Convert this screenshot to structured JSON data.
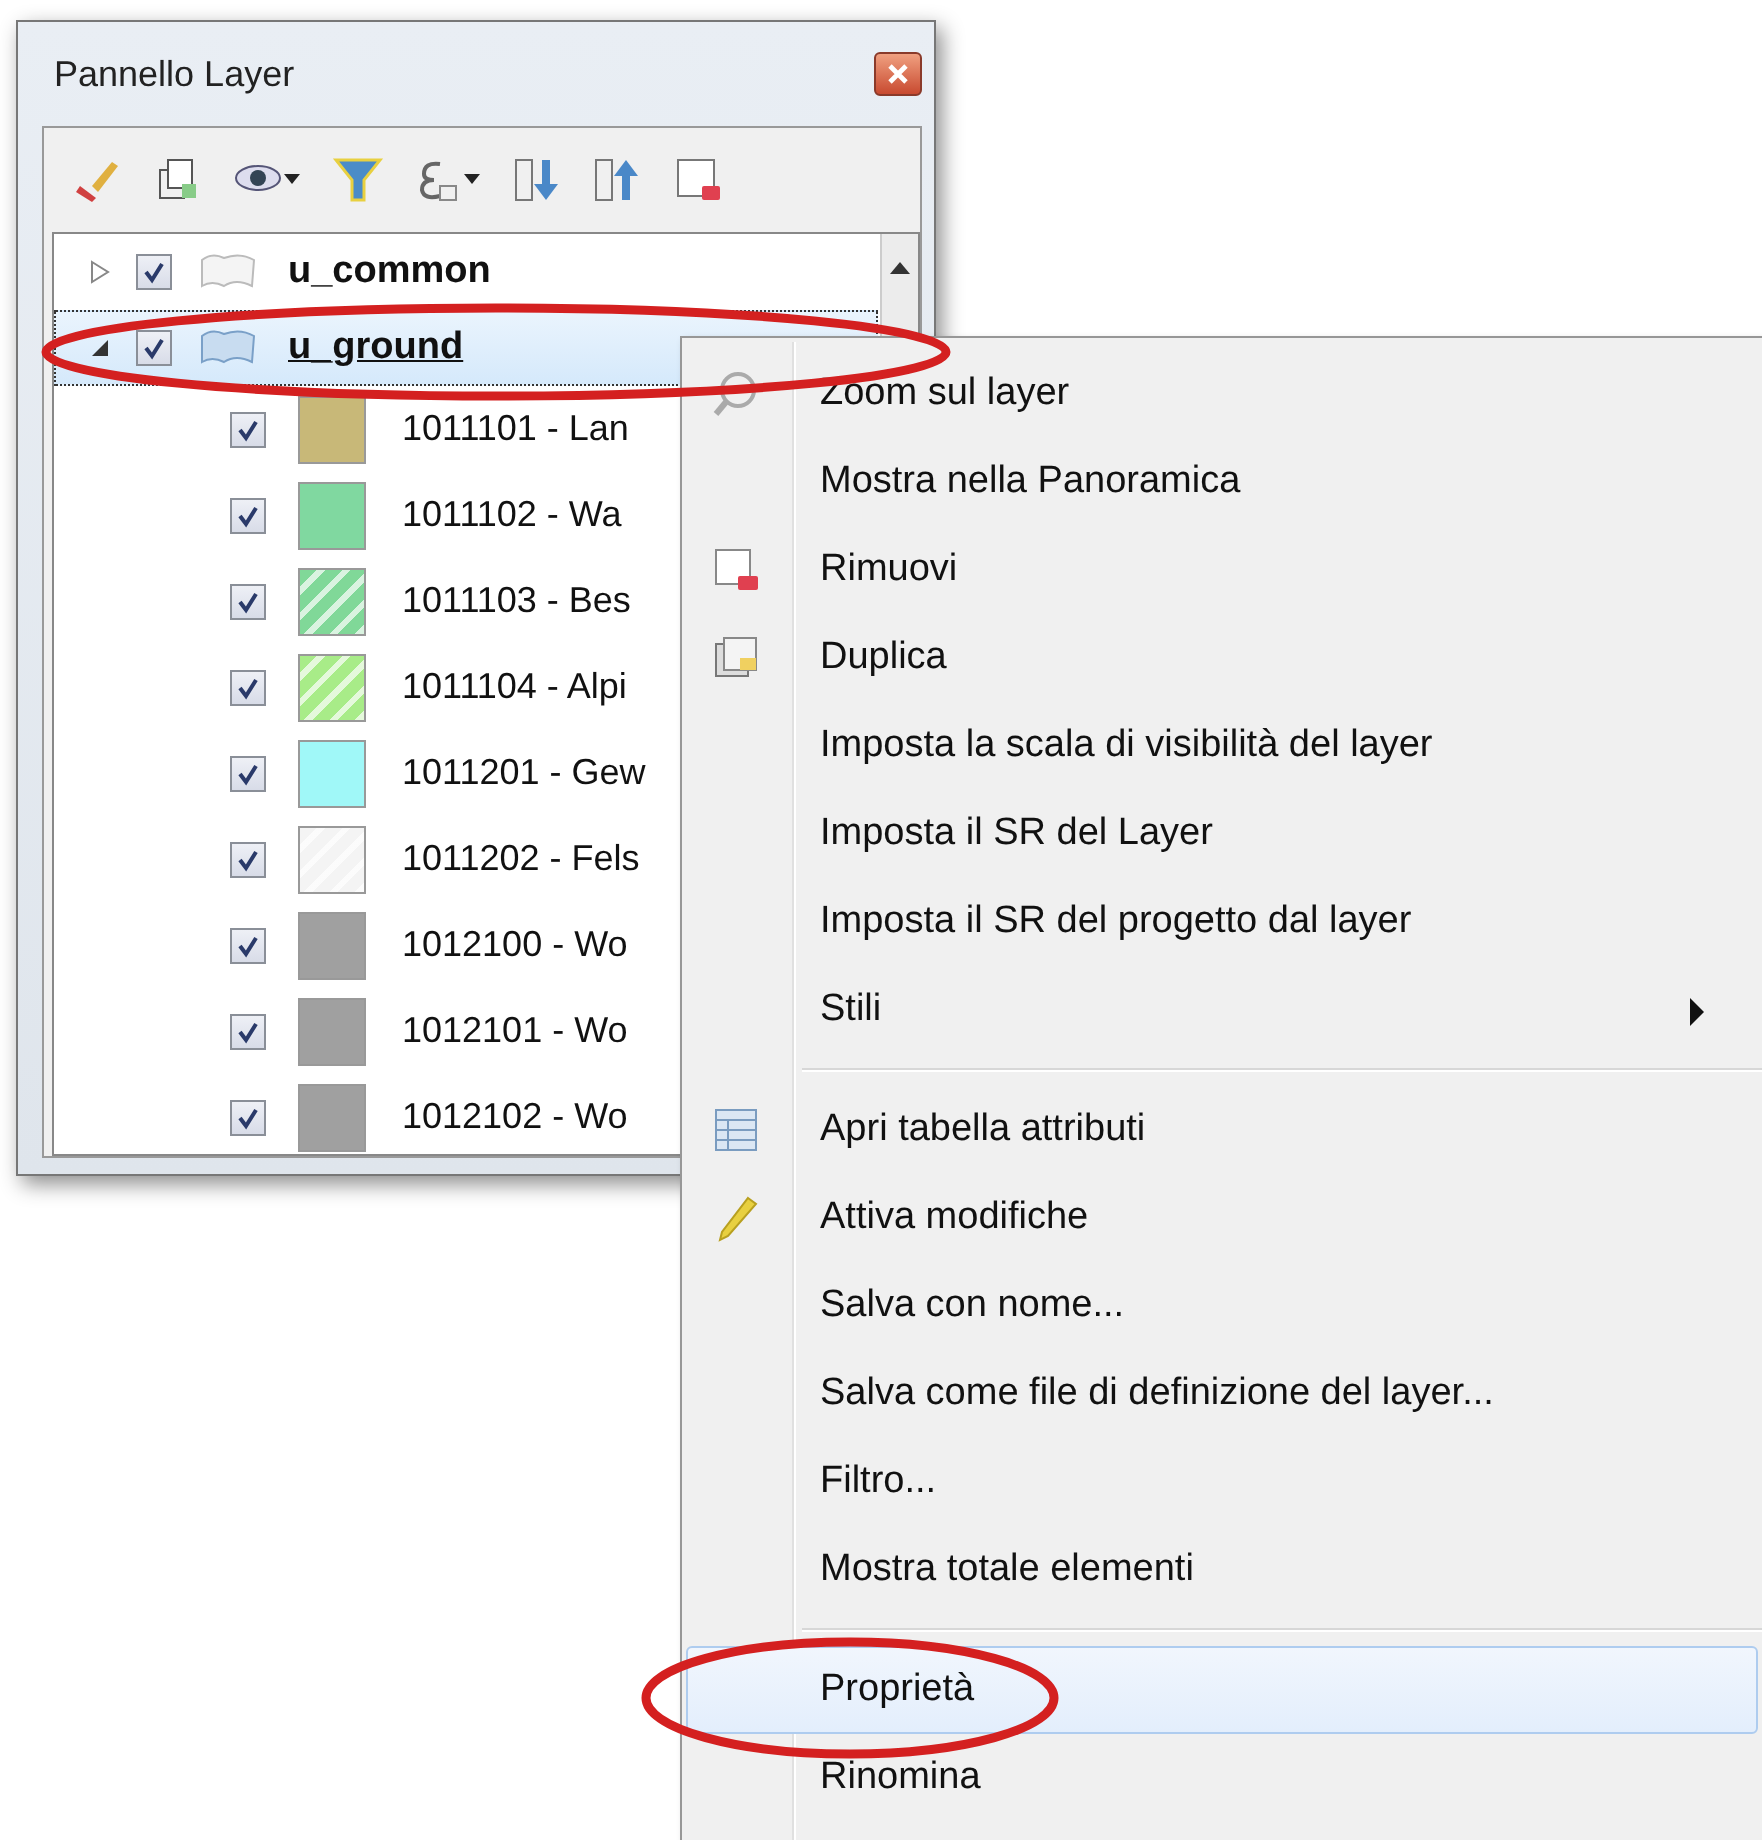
{
  "panel": {
    "title": "Pannello Layer",
    "toolbar": [
      {
        "kind": "brush"
      },
      {
        "kind": "add-group"
      },
      {
        "kind": "eye",
        "dropdown": true
      },
      {
        "kind": "filter"
      },
      {
        "kind": "expression",
        "dropdown": true
      },
      {
        "kind": "expand"
      },
      {
        "kind": "collapse"
      },
      {
        "kind": "remove"
      }
    ],
    "tree": [
      {
        "label": "u_common",
        "checked": true,
        "expanded": false,
        "selected": false
      },
      {
        "label": "u_ground",
        "checked": true,
        "expanded": true,
        "selected": true,
        "children": [
          {
            "label": "1011101 - Lan",
            "checked": true,
            "color": "#c8b878",
            "hatched": false
          },
          {
            "label": "1011102 - Wa",
            "checked": true,
            "color": "#80d8a0",
            "hatched": false
          },
          {
            "label": "1011103 - Bes",
            "checked": true,
            "color": "#80d898",
            "hatched": true
          },
          {
            "label": "1011104 - Alpi",
            "checked": true,
            "color": "#a8ec88",
            "hatched": true
          },
          {
            "label": "1011201 - Gew",
            "checked": true,
            "color": "#a0f8f8",
            "hatched": false
          },
          {
            "label": "1011202 - Fels",
            "checked": true,
            "color": "#f4f4f4",
            "hatched": true
          },
          {
            "label": "1012100 - Wo",
            "checked": true,
            "color": "#a0a0a0",
            "hatched": false
          },
          {
            "label": "1012101 - Wo",
            "checked": true,
            "color": "#a0a0a0",
            "hatched": false
          },
          {
            "label": "1012102 - Wo",
            "checked": true,
            "color": "#a0a0a0",
            "hatched": false
          }
        ]
      }
    ]
  },
  "context_menu": {
    "sections": [
      [
        {
          "label": "Zoom sul layer",
          "selected": false,
          "submenu": false
        },
        {
          "label": "Mostra nella Panoramica",
          "selected": false,
          "submenu": false
        },
        {
          "label": "Rimuovi",
          "selected": false,
          "submenu": false
        },
        {
          "label": "Duplica",
          "selected": false,
          "submenu": false
        },
        {
          "label": "Imposta la scala di visibilità del layer",
          "selected": false,
          "submenu": false
        },
        {
          "label": "Imposta il SR del Layer",
          "selected": false,
          "submenu": false
        },
        {
          "label": "Imposta il SR del progetto dal layer",
          "selected": false,
          "submenu": false
        },
        {
          "label": "Stili",
          "selected": false,
          "submenu": true
        }
      ],
      [
        {
          "label": "Apri tabella attributi",
          "selected": false,
          "submenu": false
        },
        {
          "label": "Attiva modifiche",
          "selected": false,
          "submenu": false
        },
        {
          "label": "Salva con nome...",
          "selected": false,
          "submenu": false
        },
        {
          "label": "Salva come file di definizione del layer...",
          "selected": false,
          "submenu": false
        },
        {
          "label": "Filtro...",
          "selected": false,
          "submenu": false
        },
        {
          "label": "Mostra totale elementi",
          "selected": false,
          "submenu": false
        }
      ],
      [
        {
          "label": "Proprietà",
          "selected": true,
          "submenu": false
        },
        {
          "label": "Rinomina",
          "selected": false,
          "submenu": false
        }
      ]
    ]
  },
  "annotations": [
    {
      "kind": "ellipse"
    },
    {
      "kind": "ellipse"
    }
  ]
}
